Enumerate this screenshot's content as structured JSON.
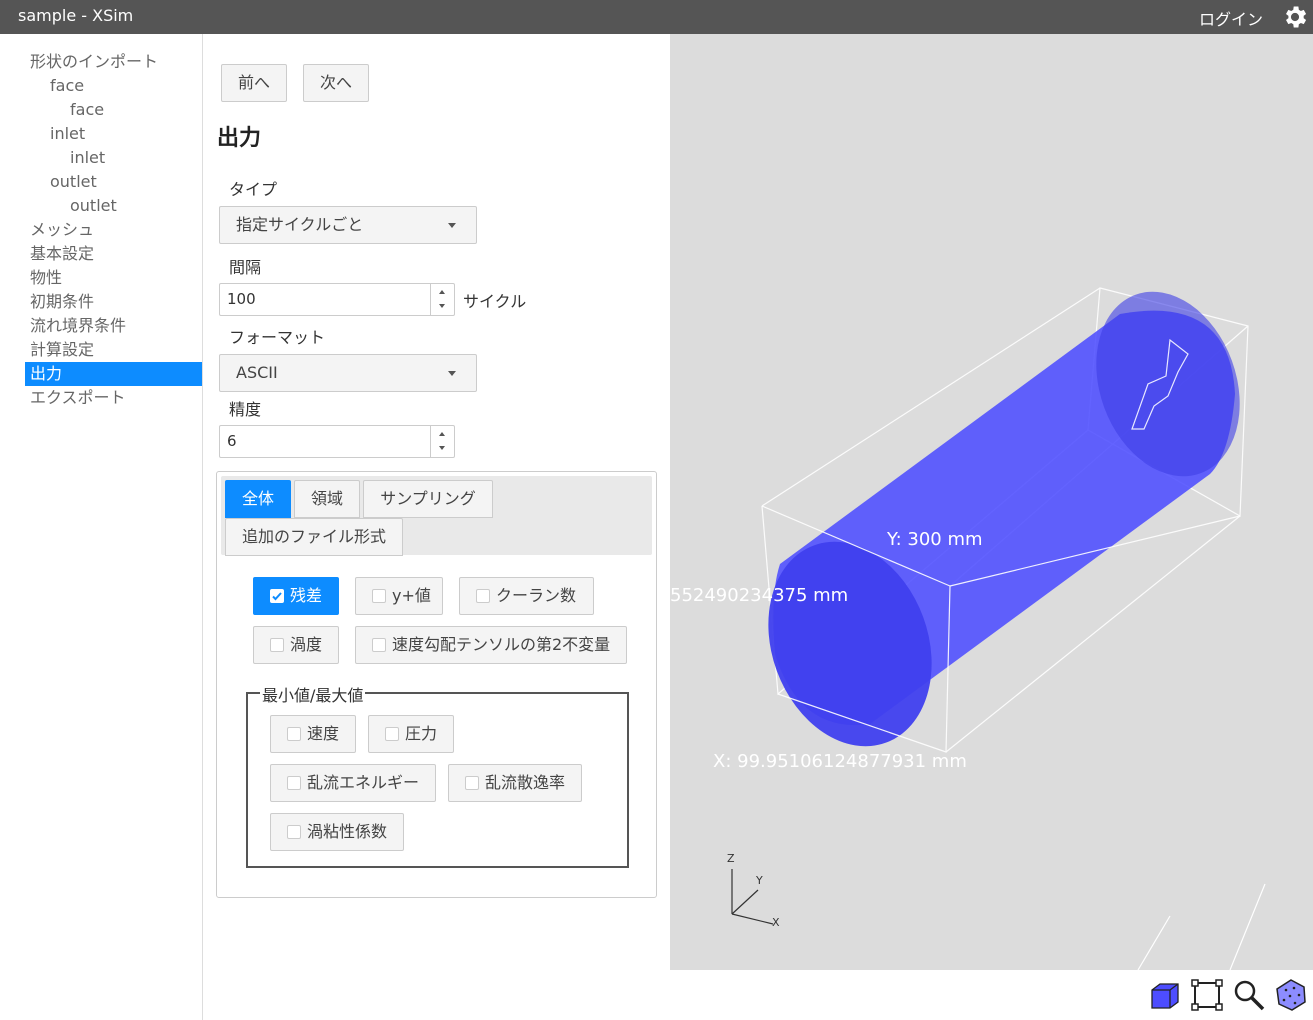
{
  "window": {
    "title": "sample - XSim",
    "login_label": "ログイン"
  },
  "sidebar": {
    "items": [
      {
        "label": "形状のインポート",
        "level": 0
      },
      {
        "label": "face",
        "level": 1
      },
      {
        "label": "face",
        "level": 2
      },
      {
        "label": "inlet",
        "level": 1
      },
      {
        "label": "inlet",
        "level": 2
      },
      {
        "label": "outlet",
        "level": 1
      },
      {
        "label": "outlet",
        "level": 2
      },
      {
        "label": "メッシュ",
        "level": 0
      },
      {
        "label": "基本設定",
        "level": 0
      },
      {
        "label": "物性",
        "level": 0
      },
      {
        "label": "初期条件",
        "level": 0
      },
      {
        "label": "流れ境界条件",
        "level": 0
      },
      {
        "label": "計算設定",
        "level": 0
      },
      {
        "label": "出力",
        "level": 0,
        "active": true
      },
      {
        "label": "エクスポート",
        "level": 0
      }
    ]
  },
  "main": {
    "prev_label": "前へ",
    "next_label": "次へ",
    "title": "出力",
    "type_label": "タイプ",
    "type_value": "指定サイクルごと",
    "interval_label": "間隔",
    "interval_value": "100",
    "interval_unit": "サイクル",
    "format_label": "フォーマット",
    "format_value": "ASCII",
    "precision_label": "精度",
    "precision_value": "6",
    "tabs": [
      {
        "label": "全体",
        "active": true
      },
      {
        "label": "領域"
      },
      {
        "label": "サンプリング"
      },
      {
        "label": "追加のファイル形式"
      }
    ],
    "options": {
      "residual": {
        "label": "残差",
        "checked": true
      },
      "yplus": {
        "label": "y+値",
        "checked": false
      },
      "courant": {
        "label": "クーラン数",
        "checked": false
      },
      "vorticity": {
        "label": "渦度",
        "checked": false
      },
      "q_criterion": {
        "label": "速度勾配テンソルの第2不変量",
        "checked": false
      }
    },
    "minmax": {
      "legend": "最小値/最大値",
      "velocity": "速度",
      "pressure": "圧力",
      "tke": "乱流エネルギー",
      "dissipation": "乱流散逸率",
      "eddy_viscosity": "渦粘性係数"
    }
  },
  "viewport": {
    "dim_y": "Y: 300 mm",
    "dim_z": "552490234375 mm",
    "dim_x": "X: 99.95106124877931 mm",
    "axis_z": "Z",
    "axis_y": "Y",
    "axis_x": "X",
    "colors": {
      "cylinder": "#4d4dff",
      "background": "#dcdcdc",
      "accent": "#0d8cff"
    }
  },
  "tools": [
    "solid-view-icon",
    "fit-frame-icon",
    "zoom-icon",
    "mesh-points-icon"
  ]
}
